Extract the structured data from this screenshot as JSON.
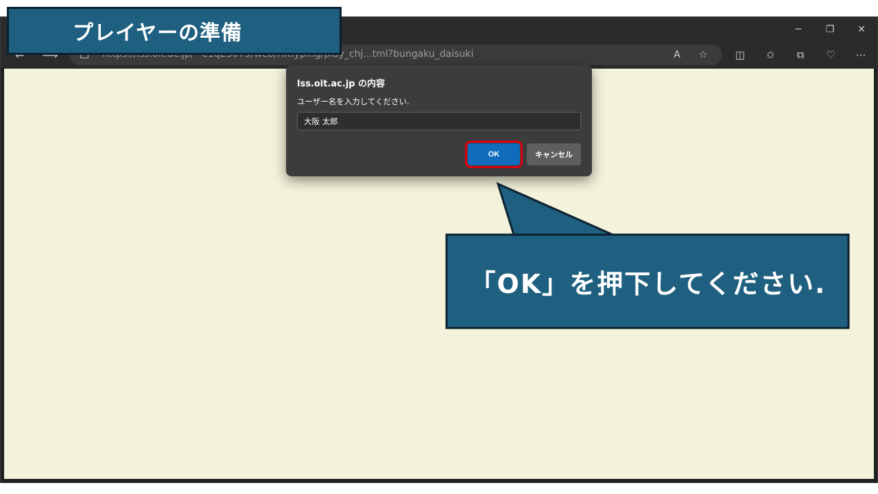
{
  "banner": {
    "title": "プレイヤーの準備"
  },
  "browser": {
    "url": "https://lss.oit.ac.jp/~e1q23075/web/HKTyping/play_chj...tml?bungaku_daisuki",
    "window_controls": {
      "minimize": "─",
      "restore": "❐",
      "close": "✕"
    },
    "nav": {
      "back": "←",
      "forward": "⟶"
    },
    "address_icons": {
      "read_aloud": "A",
      "favorite": "☆"
    },
    "toolbar_icons": {
      "split": "◫",
      "favorites": "✩",
      "collections": "⧉",
      "health": "♡",
      "more": "⋯"
    },
    "page_background": "#f3f2da"
  },
  "dialog": {
    "title": "lss.oit.ac.jp の内容",
    "message": "ユーザー名を入力してください.",
    "input_value": "大阪 太郎",
    "ok_label": "OK",
    "cancel_label": "キャンセル"
  },
  "callout": {
    "text": "「OK」を押下してください.",
    "fill": "#1f6080",
    "border": "#0c2130"
  },
  "colors": {
    "highlight": "#e00010",
    "accent": "#0f6cbd"
  }
}
